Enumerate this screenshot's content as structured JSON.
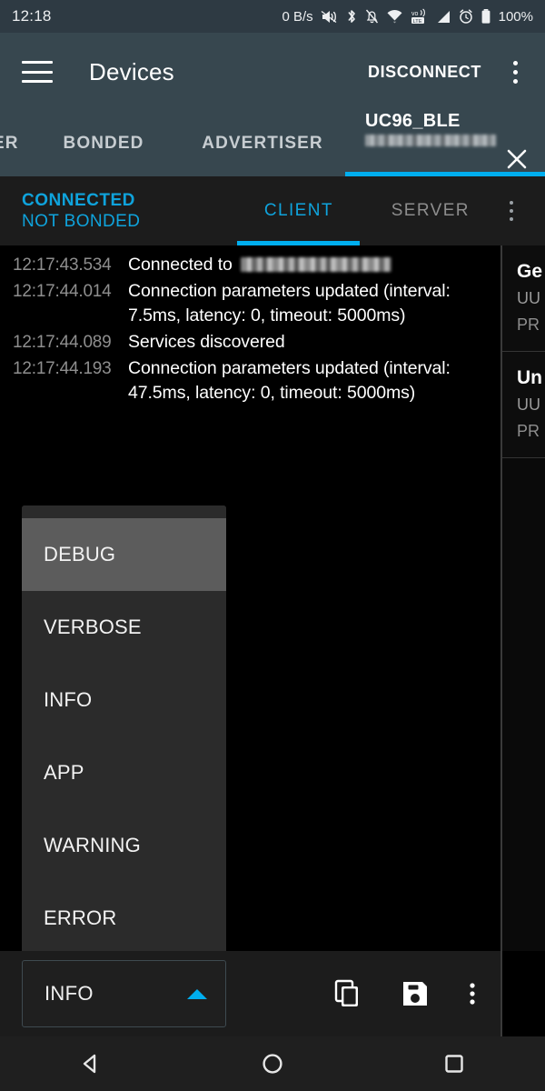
{
  "status_bar": {
    "time": "12:18",
    "data_rate": "0 B/s",
    "battery": "100%",
    "icons": [
      "megaphone-icon",
      "bluetooth-icon",
      "notifications-muted-icon",
      "wifi-icon",
      "volte-icon",
      "cellular-signal-icon",
      "alarm-icon",
      "battery-icon"
    ]
  },
  "app_bar": {
    "menu_icon": "hamburger-menu-icon",
    "title": "Devices",
    "action": "DISCONNECT",
    "overflow_icon": "overflow-menu-icon"
  },
  "tabs": [
    {
      "label": "ER",
      "full": "SCANNER",
      "active": false
    },
    {
      "label": "BONDED",
      "active": false
    },
    {
      "label": "ADVERTISER",
      "active": false
    },
    {
      "label": "UC96_BLE",
      "address": "redacted",
      "active": true,
      "close_icon": "close-icon"
    }
  ],
  "connection": {
    "state": "CONNECTED",
    "bond_state": "NOT BONDED",
    "accent_color": "#0FA3DC",
    "tabs": [
      {
        "label": "CLIENT",
        "active": true
      },
      {
        "label": "SERVER",
        "active": false
      }
    ],
    "overflow_icon": "overflow-menu-icon"
  },
  "log": {
    "entries": [
      {
        "time": "12:17:43.534",
        "message": "Connected to ",
        "redacted": true
      },
      {
        "time": "12:17:44.014",
        "message": "Connection parameters updated (interval: 7.5ms, latency: 0, timeout: 5000ms)",
        "redacted": false
      },
      {
        "time": "12:17:44.089",
        "message": "Services discovered",
        "redacted": false
      },
      {
        "time": "12:17:44.193",
        "message": "Connection parameters updated (interval: 47.5ms, latency: 0, timeout: 5000ms)",
        "redacted": false
      }
    ]
  },
  "services_panel": {
    "cards": [
      {
        "name": "Ge",
        "uuid": "UU",
        "type": "PR"
      },
      {
        "name": "Un",
        "uuid": "UU",
        "type": "PR"
      }
    ]
  },
  "log_level_menu": {
    "items": [
      {
        "label": "DEBUG",
        "selected": true
      },
      {
        "label": "VERBOSE",
        "selected": false
      },
      {
        "label": "INFO",
        "selected": false
      },
      {
        "label": "APP",
        "selected": false
      },
      {
        "label": "WARNING",
        "selected": false
      },
      {
        "label": "ERROR",
        "selected": false
      }
    ]
  },
  "bottom_bar": {
    "spinner_value": "INFO",
    "caret_icon": "caret-up-icon",
    "copy_icon": "copy-icon",
    "save_icon": "save-icon",
    "overflow_icon": "overflow-menu-icon"
  },
  "nav_bar": {
    "back_icon": "back-triangle-icon",
    "home_icon": "home-circle-icon",
    "recents_icon": "recents-square-icon"
  }
}
